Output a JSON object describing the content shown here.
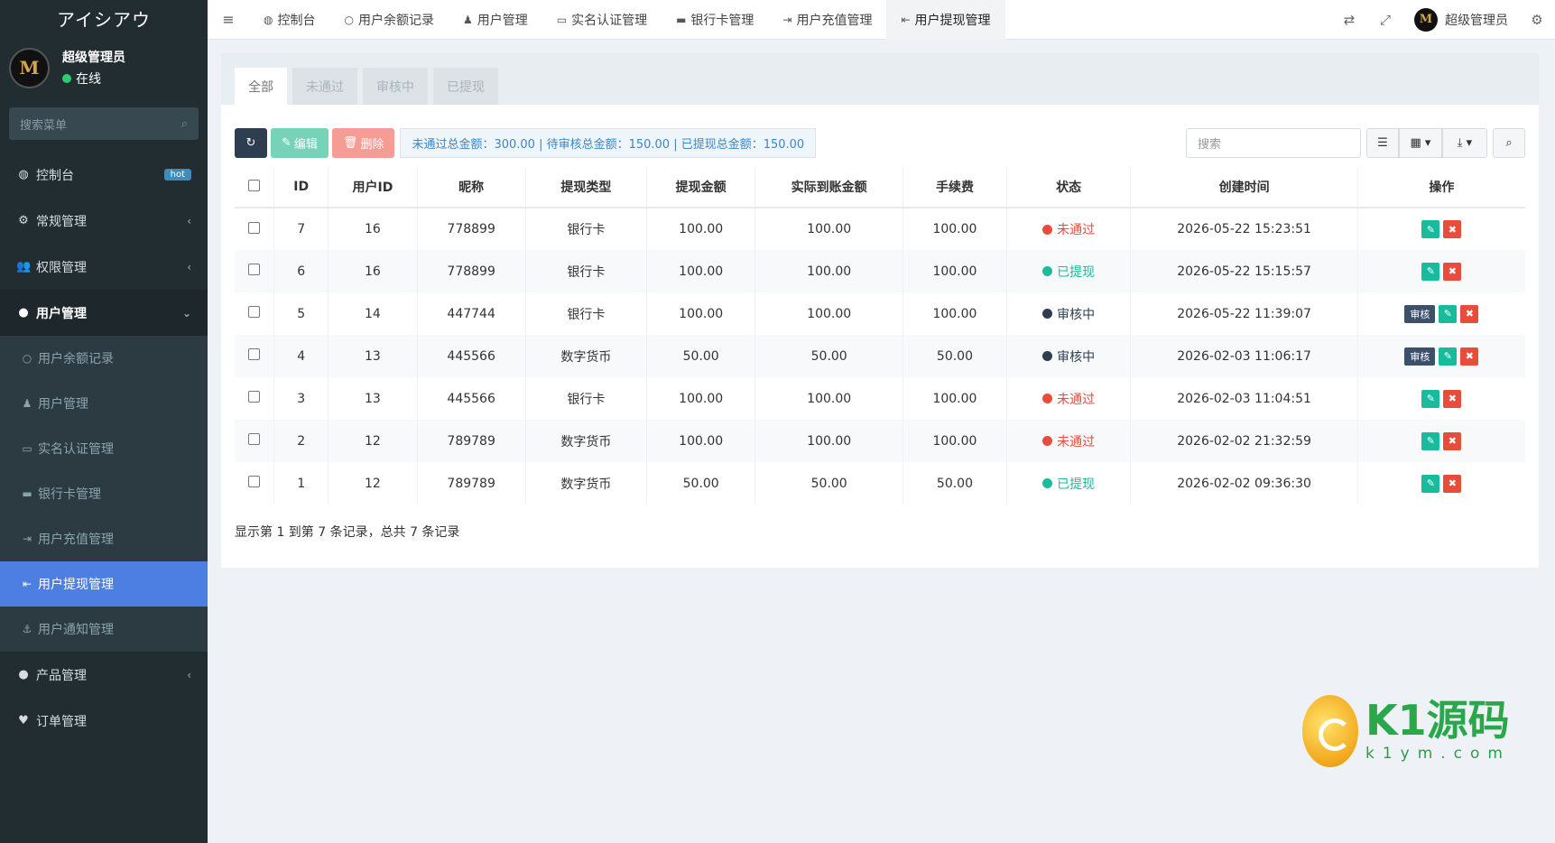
{
  "brand": "アイシアウ",
  "user": {
    "name": "超级管理员",
    "status": "在线",
    "status_color": "#2ecc71",
    "avatar_text": "M"
  },
  "sidebar": {
    "search_placeholder": "搜索菜单",
    "items": [
      {
        "icon": "dashboard-icon",
        "glyph": "◍",
        "label": "控制台",
        "badge": "hot"
      },
      {
        "icon": "cogs-icon",
        "glyph": "⚙",
        "label": "常规管理",
        "arrow": "‹"
      },
      {
        "icon": "users-icon",
        "glyph": "👥",
        "label": "权限管理",
        "arrow": "‹"
      },
      {
        "icon": "user-circle-icon",
        "glyph": "●",
        "label": "用户管理",
        "arrow": "⌄"
      }
    ],
    "sub_items": [
      {
        "icon": "circle-icon",
        "glyph": "○",
        "label": "用户余额记录"
      },
      {
        "icon": "user-icon",
        "glyph": "♟",
        "label": "用户管理"
      },
      {
        "icon": "id-card-icon",
        "glyph": "▭",
        "label": "实名认证管理"
      },
      {
        "icon": "credit-card-icon",
        "glyph": "▬",
        "label": "银行卡管理"
      },
      {
        "icon": "sign-in-icon",
        "glyph": "⇥",
        "label": "用户充值管理"
      },
      {
        "icon": "sign-out-icon",
        "glyph": "⇤",
        "label": "用户提现管理",
        "active": true
      },
      {
        "icon": "anchor-icon",
        "glyph": "⚓",
        "label": "用户通知管理"
      }
    ],
    "bottom_items": [
      {
        "icon": "product-hunt-icon",
        "glyph": "●",
        "label": "产品管理",
        "arrow": "‹"
      },
      {
        "icon": "heartbeat-icon",
        "glyph": "♥",
        "label": "订单管理"
      }
    ]
  },
  "header": {
    "tabs": [
      {
        "icon": "dashboard-icon",
        "glyph": "◍",
        "label": "控制台"
      },
      {
        "icon": "circle-icon",
        "glyph": "○",
        "label": "用户余额记录"
      },
      {
        "icon": "user-icon",
        "glyph": "♟",
        "label": "用户管理"
      },
      {
        "icon": "id-card-icon",
        "glyph": "▭",
        "label": "实名认证管理"
      },
      {
        "icon": "credit-card-icon",
        "glyph": "▬",
        "label": "银行卡管理"
      },
      {
        "icon": "sign-in-icon",
        "glyph": "⇥",
        "label": "用户充值管理"
      },
      {
        "icon": "sign-out-icon",
        "glyph": "⇤",
        "label": "用户提现管理",
        "active": true
      }
    ],
    "user_name": "超级管理员"
  },
  "filter_tabs": [
    "全部",
    "未通过",
    "审核中",
    "已提现"
  ],
  "toolbar": {
    "edit_label": "编辑",
    "delete_label": "删除",
    "summary": "未通过总金额：300.00 | 待审核总金额：150.00 | 已提现总金额：150.00",
    "search_placeholder": "搜索"
  },
  "table": {
    "columns": [
      "ID",
      "用户ID",
      "昵称",
      "提现类型",
      "提现金额",
      "实际到账金额",
      "手续费",
      "状态",
      "创建时间",
      "操作"
    ],
    "rows": [
      {
        "id": "7",
        "user_id": "16",
        "nickname": "778899",
        "type": "银行卡",
        "amount": "100.00",
        "actual": "100.00",
        "fee": "100.00",
        "status": "未通过",
        "status_key": "rejected",
        "created": "2026-05-22 15:23:51",
        "audit": false
      },
      {
        "id": "6",
        "user_id": "16",
        "nickname": "778899",
        "type": "银行卡",
        "amount": "100.00",
        "actual": "100.00",
        "fee": "100.00",
        "status": "已提现",
        "status_key": "done",
        "created": "2026-05-22 15:15:57",
        "audit": false
      },
      {
        "id": "5",
        "user_id": "14",
        "nickname": "447744",
        "type": "银行卡",
        "amount": "100.00",
        "actual": "100.00",
        "fee": "100.00",
        "status": "审核中",
        "status_key": "pending",
        "created": "2026-05-22 11:39:07",
        "audit": true
      },
      {
        "id": "4",
        "user_id": "13",
        "nickname": "445566",
        "type": "数字货币",
        "amount": "50.00",
        "actual": "50.00",
        "fee": "50.00",
        "status": "审核中",
        "status_key": "pending",
        "created": "2026-02-03 11:06:17",
        "audit": true
      },
      {
        "id": "3",
        "user_id": "13",
        "nickname": "445566",
        "type": "银行卡",
        "amount": "100.00",
        "actual": "100.00",
        "fee": "100.00",
        "status": "未通过",
        "status_key": "rejected",
        "created": "2026-02-03 11:04:51",
        "audit": false
      },
      {
        "id": "2",
        "user_id": "12",
        "nickname": "789789",
        "type": "数字货币",
        "amount": "100.00",
        "actual": "100.00",
        "fee": "100.00",
        "status": "未通过",
        "status_key": "rejected",
        "created": "2026-02-02 21:32:59",
        "audit": false
      },
      {
        "id": "1",
        "user_id": "12",
        "nickname": "789789",
        "type": "数字货币",
        "amount": "50.00",
        "actual": "50.00",
        "fee": "50.00",
        "status": "已提现",
        "status_key": "done",
        "created": "2026-02-02 09:36:30",
        "audit": false
      }
    ],
    "audit_label": "审核"
  },
  "pager_info": "显示第 1 到第 7 条记录，总共 7 条记录",
  "status_colors": {
    "rejected": "#e74c3c",
    "done": "#1abc9c",
    "pending": "#2c3e50"
  },
  "watermark": {
    "brand": "K1源码",
    "domain": "k1ym.com"
  }
}
